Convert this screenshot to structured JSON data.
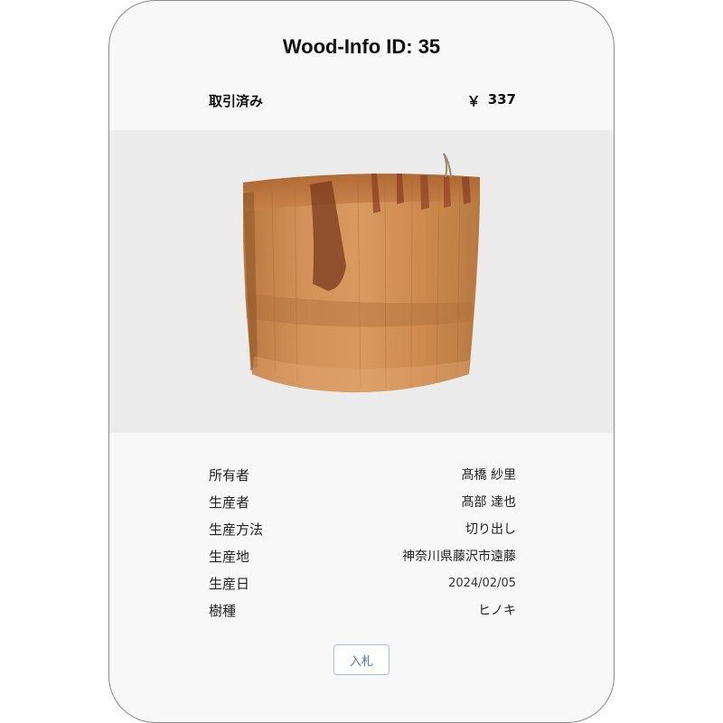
{
  "card": {
    "title": "Wood-Info ID: 35",
    "status": "取引済み",
    "price_symbol": "￥",
    "price_value": "337"
  },
  "image": {
    "description_icon": "wood-log-image"
  },
  "details": [
    {
      "label": "所有者",
      "value": "髙橋 紗里"
    },
    {
      "label": "生産者",
      "value": "髙部 達也"
    },
    {
      "label": "生産方法",
      "value": "切り出し"
    },
    {
      "label": "生産地",
      "value": "神奈川県藤沢市遠藤"
    },
    {
      "label": "生産日",
      "value": "2024/02/05"
    },
    {
      "label": "樹種",
      "value": "ヒノキ"
    }
  ],
  "actions": {
    "bid_label": "入札",
    "accent_color": "#4a78bd"
  }
}
